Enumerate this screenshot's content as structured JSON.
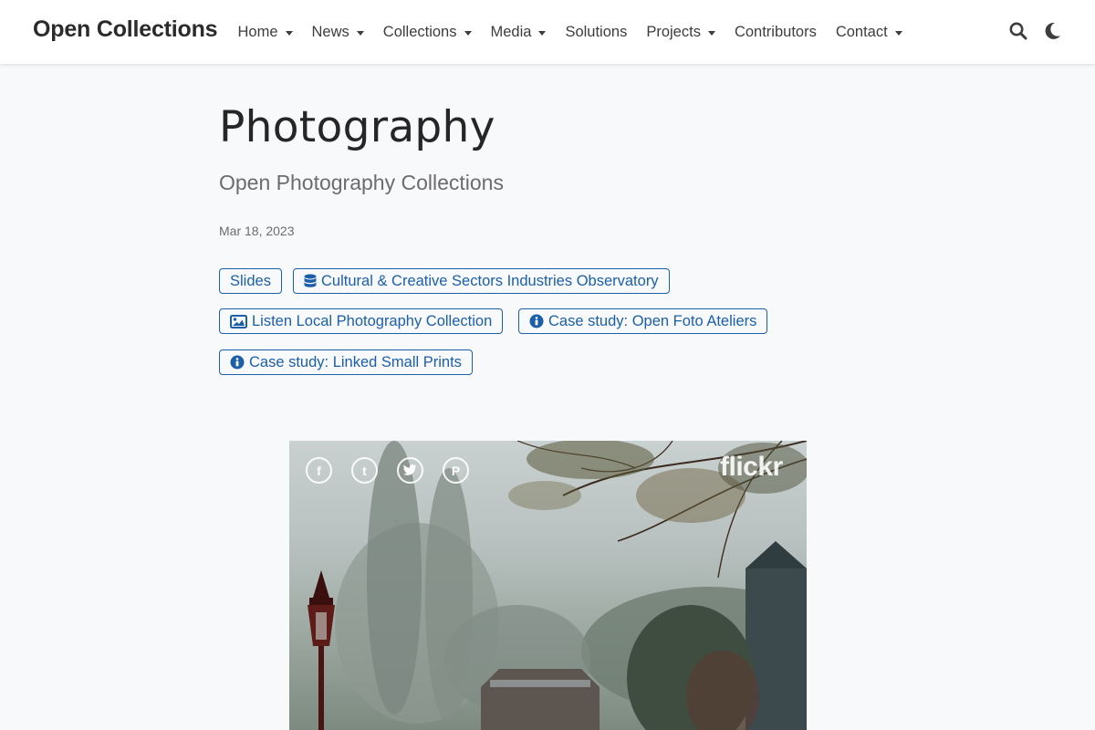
{
  "brand": "Open Collections",
  "nav": [
    {
      "label": "Home",
      "dropdown": true
    },
    {
      "label": "News",
      "dropdown": true
    },
    {
      "label": "Collections",
      "dropdown": true
    },
    {
      "label": "Media",
      "dropdown": true
    },
    {
      "label": "Solutions",
      "dropdown": false
    },
    {
      "label": "Projects",
      "dropdown": true
    },
    {
      "label": "Contributors",
      "dropdown": false
    },
    {
      "label": "Contact",
      "dropdown": true
    }
  ],
  "icons": {
    "search": "search-icon",
    "theme": "moon-icon"
  },
  "page": {
    "title": "Photography",
    "subtitle": "Open Photography Collections",
    "date": "Mar 18, 2023"
  },
  "tags": [
    {
      "label": "Slides",
      "icon": ""
    },
    {
      "label": "Cultural & Creative Sectors Industries Observatory",
      "icon": "database-icon"
    },
    {
      "label": "Listen Local Photography Collection",
      "icon": "image-icon"
    },
    {
      "label": "Case study: Open Foto Ateliers",
      "icon": "info-icon"
    },
    {
      "label": "Case study: Linked Small Prints",
      "icon": "info-icon"
    }
  ],
  "embed": {
    "share_icons": [
      "facebook-icon",
      "tumblr-icon",
      "twitter-icon",
      "pinterest-icon"
    ],
    "share_glyphs": [
      "f",
      "t",
      "",
      "P"
    ],
    "logo": "flickr"
  },
  "colors": {
    "accent": "#1c5fa9",
    "text": "#2b2b2b",
    "muted": "#6c6c6c",
    "background": "#f8f9fb"
  }
}
